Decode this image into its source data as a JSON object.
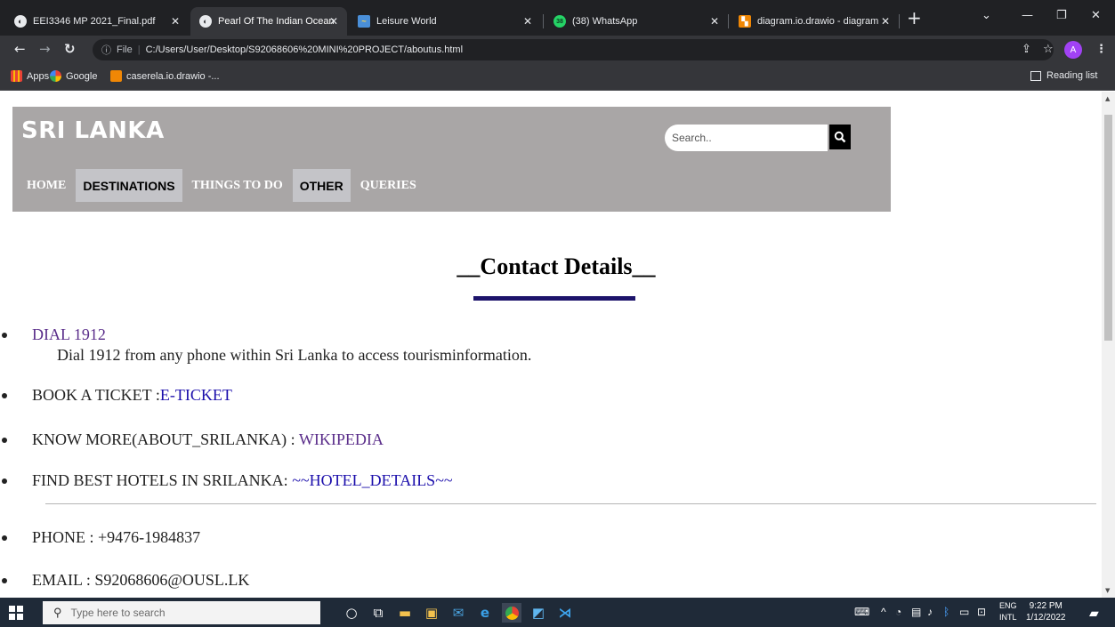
{
  "browser": {
    "tabs": [
      {
        "title": "EEI3346 MP 2021_Final.pdf",
        "icon": "globe-icon",
        "active": false
      },
      {
        "title": "Pearl Of The Indian Ocean",
        "icon": "globe-icon",
        "active": true
      },
      {
        "title": "Leisure World",
        "icon": "leisure-icon",
        "active": false
      },
      {
        "title": "(38) WhatsApp",
        "icon": "whatsapp-icon",
        "active": false
      },
      {
        "title": "diagram.io.drawio - diagram",
        "icon": "drawio-icon",
        "active": false
      }
    ],
    "whatsapp_badge": "38",
    "address": {
      "scheme_label": "File",
      "url": "C:/Users/User/Desktop/S92068606%20MINI%20PROJECT/aboutus.html"
    },
    "profile_initial": "A",
    "bookmarks": [
      {
        "label": "Apps",
        "icon": "apps-icon"
      },
      {
        "label": "Google",
        "icon": "google-icon"
      },
      {
        "label": "caserela.io.drawio -...",
        "icon": "drawio-icon"
      }
    ],
    "reading_list": "Reading list"
  },
  "site": {
    "title": "SRI LANKA",
    "search_placeholder": "Search..",
    "nav": [
      {
        "label": "HOME",
        "boxed": false
      },
      {
        "label": "DESTINATIONS",
        "boxed": true
      },
      {
        "label": "THINGS TO DO",
        "boxed": false
      },
      {
        "label": "OTHER",
        "boxed": true
      },
      {
        "label": "QUERIES",
        "boxed": false
      }
    ]
  },
  "content": {
    "heading": "__Contact Details__",
    "items": [
      {
        "prefix": "",
        "link": "DIAL 1912",
        "sub": "Dial 1912 from any phone within Sri Lanka to access tourisminformation."
      },
      {
        "prefix": "BOOK A TICKET :",
        "link": "E-TICKET"
      },
      {
        "prefix": "KNOW MORE(ABOUT_SRILANKA) : ",
        "link": "WIKIPEDIA"
      },
      {
        "prefix": "FIND BEST HOTELS IN SRILANKA: ",
        "link": "~~HOTEL_DETAILS~~"
      }
    ],
    "contacts": [
      {
        "text": "PHONE : +9476-1984837"
      },
      {
        "text": "EMAIL : S92068606@OUSL.LK"
      }
    ]
  },
  "taskbar": {
    "search_placeholder": "Type here to search",
    "lang": "ENG",
    "lang_sub": "INTL",
    "time": "9:22 PM",
    "date": "1/12/2022"
  }
}
